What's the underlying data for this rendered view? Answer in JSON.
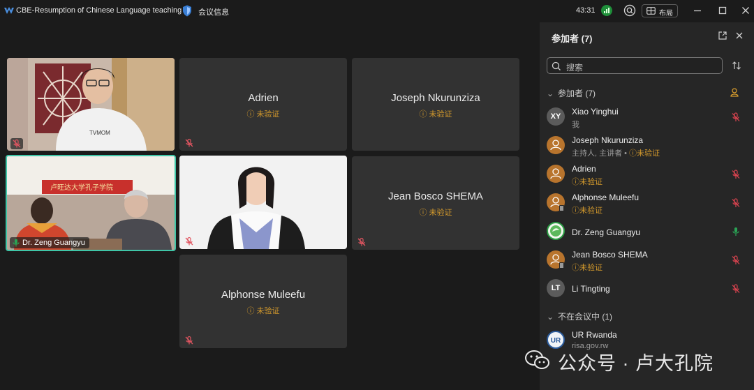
{
  "titlebar": {
    "app_title": "CBE-Resumption of Chinese Language teaching",
    "meeting_info_label": "会议信息",
    "timer": "43:31",
    "layout_label": "布局"
  },
  "grid": {
    "tiles": [
      {
        "name": "",
        "kind": "video",
        "muted": true
      },
      {
        "name": "Adrien",
        "status": "未验证",
        "muted": true
      },
      {
        "name": "Joseph Nkurunziza",
        "status": "未验证"
      },
      {
        "name": "Dr. Zeng Guangyu",
        "kind": "video",
        "speaking": true
      },
      {
        "name": "",
        "kind": "video",
        "muted": true
      },
      {
        "name": "Jean Bosco SHEMA",
        "status": "未验证",
        "muted": true
      },
      {
        "name": "Alphonse Muleefu",
        "status": "未验证",
        "muted": true
      }
    ]
  },
  "panel": {
    "title": "参加者 (7)",
    "search_placeholder": "搜索",
    "in_meeting_header": "参加者 (7)",
    "not_in_meeting_header": "不在会议中 (1)",
    "participants": [
      {
        "initials": "XY",
        "name": "Xiao Yinghui",
        "sub": "我",
        "avatar": "gray",
        "mic": "muted"
      },
      {
        "initials": "",
        "name": "Joseph Nkurunziza",
        "sub_prefix": "主持人, 主讲者 •",
        "sub": "未验证",
        "avatar": "orange",
        "mic": "none"
      },
      {
        "initials": "",
        "name": "Adrien",
        "sub": "未验证",
        "avatar": "orange",
        "mic": "muted"
      },
      {
        "initials": "",
        "name": "Alphonse Muleefu",
        "sub": "未验证",
        "avatar": "orange",
        "mic": "muted"
      },
      {
        "initials": "",
        "name": "Dr. Zeng Guangyu",
        "sub": "",
        "avatar": "green",
        "mic": "active"
      },
      {
        "initials": "",
        "name": "Jean Bosco SHEMA",
        "sub": "未验证",
        "avatar": "orange",
        "mic": "muted"
      },
      {
        "initials": "LT",
        "name": "Li Tingting",
        "sub": "",
        "avatar": "gray",
        "mic": "muted"
      }
    ],
    "not_in_meeting": [
      {
        "initials": "UR",
        "name": "UR Rwanda",
        "sub": "risa.gov.rw"
      }
    ]
  },
  "watermark": {
    "text": "公众号 · 卢大孔院"
  },
  "colors": {
    "unverified": "#d49a2c",
    "muted_mic": "#d9434f",
    "active_mic": "#2aa355",
    "speaking_border": "#3fc6a8"
  }
}
